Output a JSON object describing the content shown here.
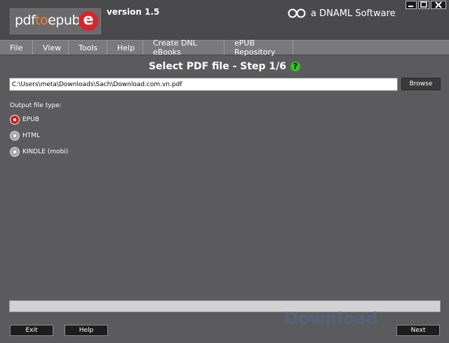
{
  "app": {
    "logo": {
      "part1": "pdf",
      "part2": "to",
      "part3": "epub",
      "badge": "e"
    },
    "version": "version 1.5",
    "brand": "a DNAML Software",
    "window_controls": {
      "minimize": "minimize-icon",
      "maximize": "maximize-icon",
      "close": "close-icon"
    }
  },
  "menu": {
    "items": [
      {
        "label": "File"
      },
      {
        "label": "View"
      },
      {
        "label": "Tools"
      },
      {
        "label": "Help"
      },
      {
        "label": "Create DNL eBooks"
      },
      {
        "label": "ePUB Repository"
      }
    ]
  },
  "step": {
    "title": "Select PDF file - Step 1/6",
    "help_icon": "?"
  },
  "file": {
    "path": "C:\\Users\\meta\\Downloads\\Sach\\Download.com.vn.pdf",
    "browse_label": "Browse"
  },
  "output": {
    "label": "Output file type:",
    "options": [
      {
        "label": "EPUB",
        "checked": true
      },
      {
        "label": "HTML",
        "checked": false
      },
      {
        "label": "KINDLE (mobi)",
        "checked": false
      }
    ]
  },
  "progress": {
    "value": 0
  },
  "buttons": {
    "exit": "Exit",
    "help": "Help",
    "next": "Next"
  },
  "watermark": "Download",
  "colors": {
    "background": "#5b5b5d",
    "accent": "#d11f26",
    "help_green": "#2fc21e"
  }
}
